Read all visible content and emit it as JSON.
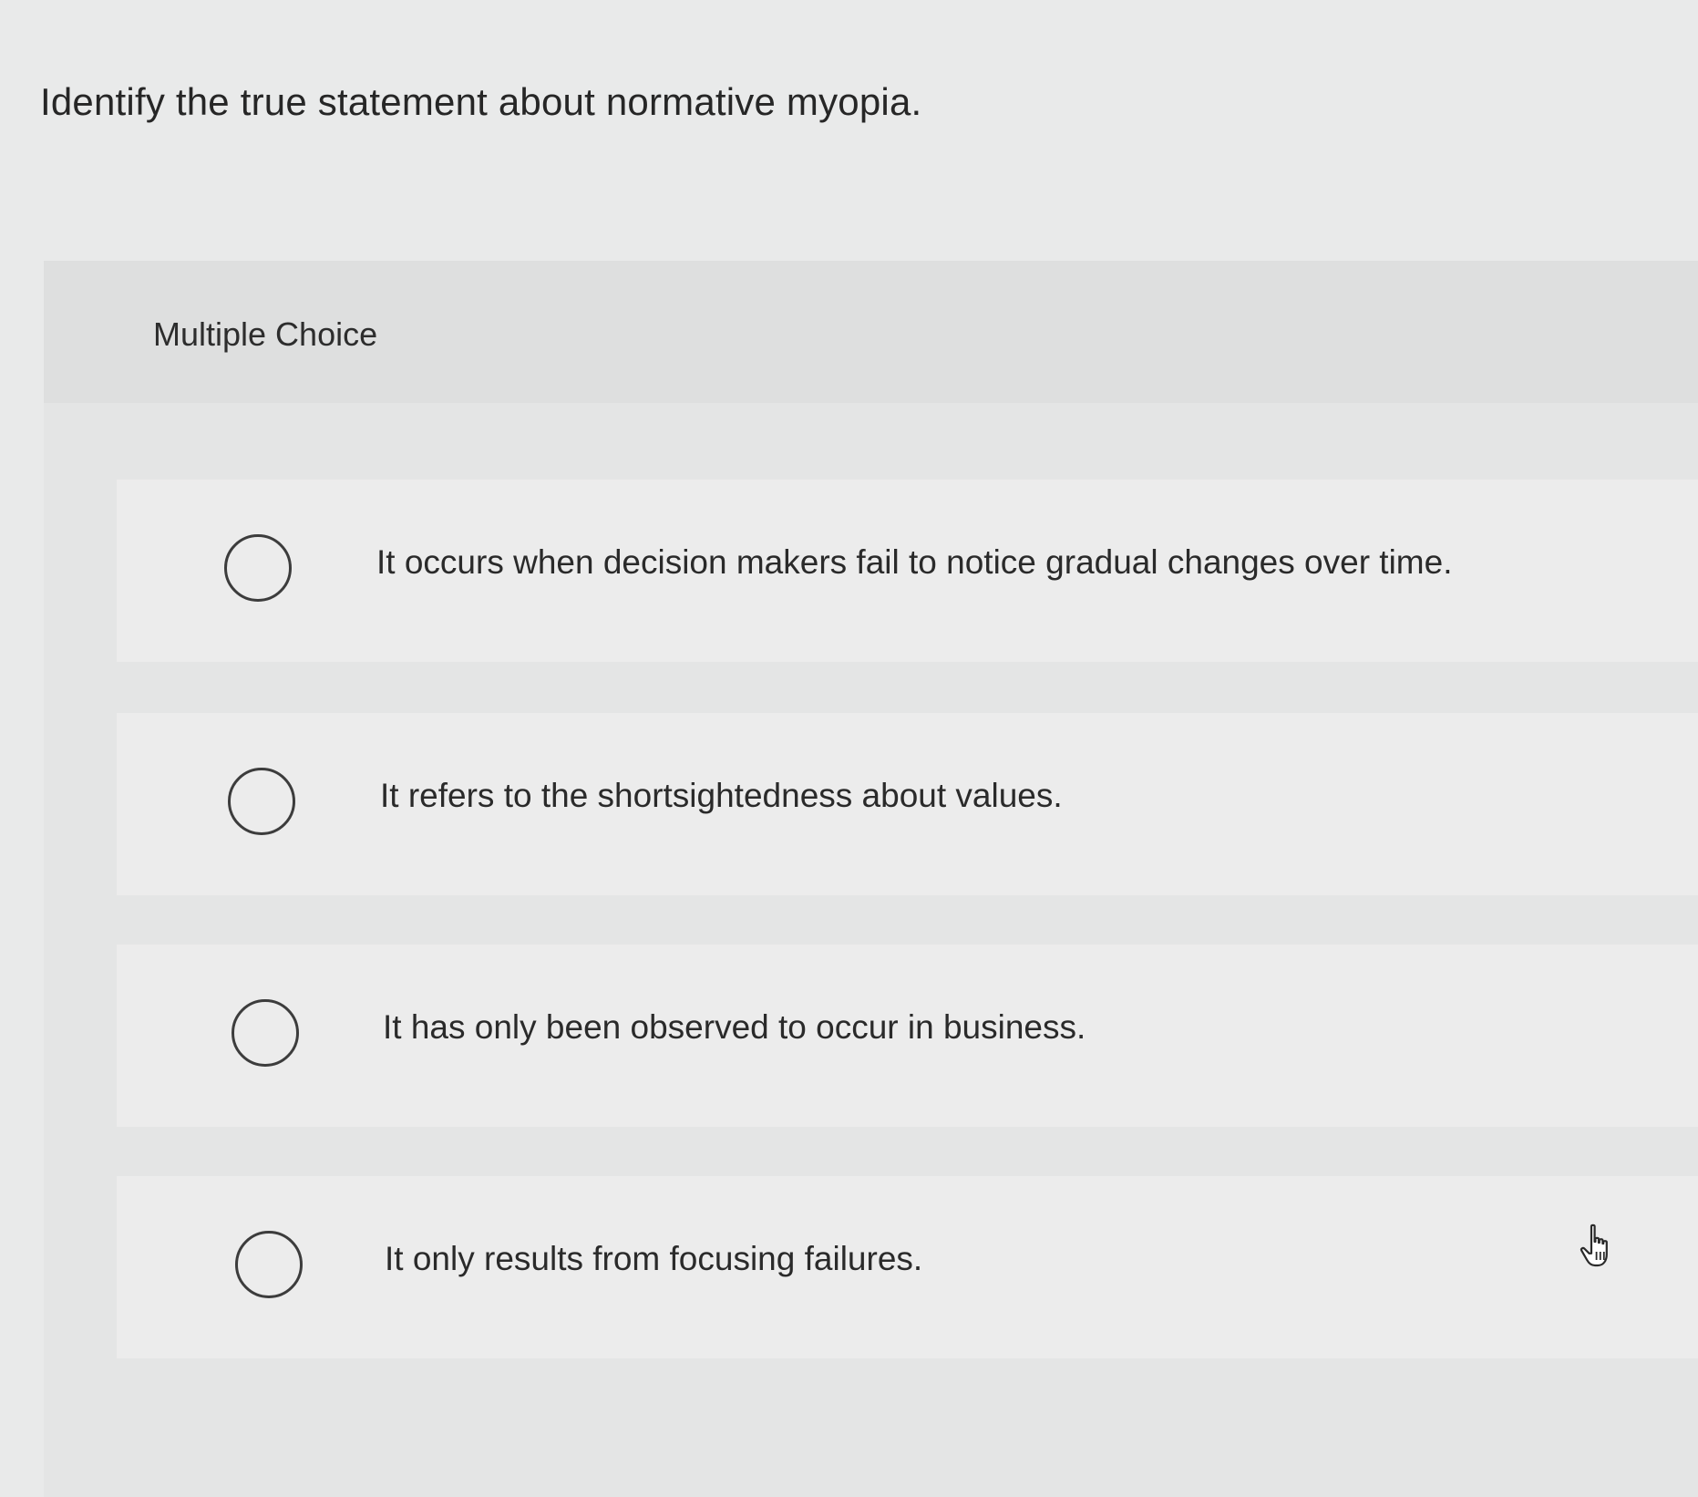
{
  "question": {
    "title": "Identify the true statement about normative myopia."
  },
  "panel": {
    "type_label": "Multiple Choice"
  },
  "options": [
    {
      "text": "It occurs when decision makers fail to notice gradual changes over time.",
      "selected": false
    },
    {
      "text": "It refers to the shortsightedness about values.",
      "selected": false
    },
    {
      "text": "It has only been observed to occur in business.",
      "selected": false
    },
    {
      "text": "It only results from focusing failures.",
      "selected": false
    }
  ],
  "icons": {
    "radio": "radio-unchecked-icon",
    "cursor": "hand-pointer-cursor-icon"
  }
}
